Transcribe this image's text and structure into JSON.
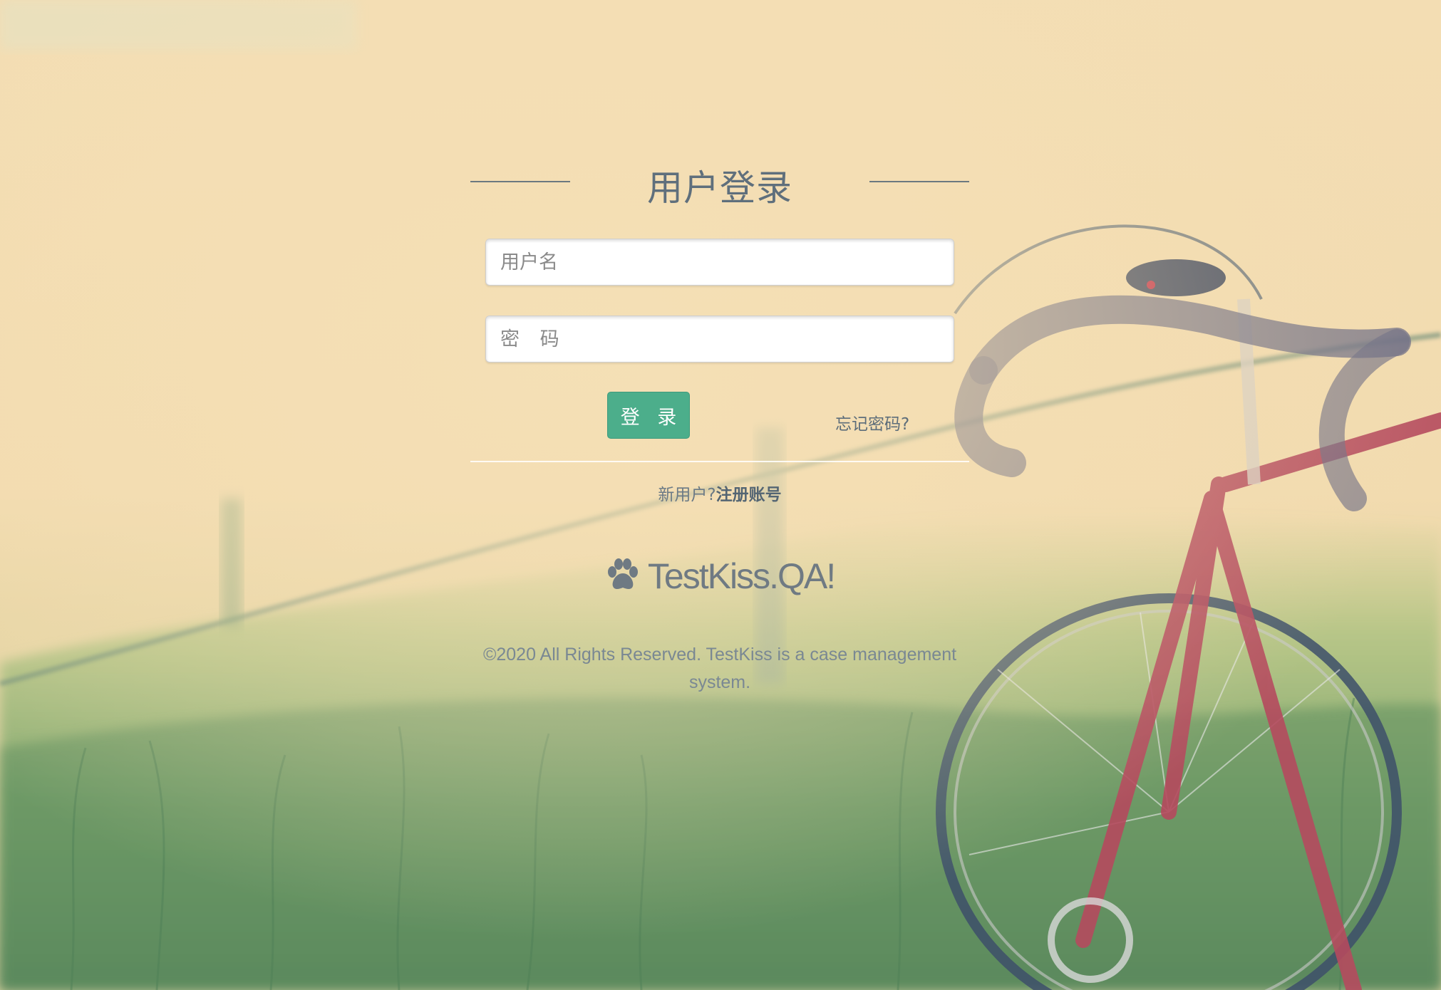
{
  "login": {
    "title": "用户登录",
    "username_placeholder": "用户名",
    "password_placeholder": "密 码",
    "submit_label": "登 录",
    "forgot_label": "忘记密码?",
    "new_user_prompt": "新用户?",
    "register_label": "注册账号"
  },
  "brand": {
    "icon": "paw-icon",
    "name": "TestKiss.QA!"
  },
  "footer": {
    "copyright": "©2020 All Rights Reserved. TestKiss is a case management system."
  },
  "colors": {
    "primary_button": "#4cae8b",
    "background": "#f2dcb1",
    "title_text": "#5f6f7c"
  }
}
